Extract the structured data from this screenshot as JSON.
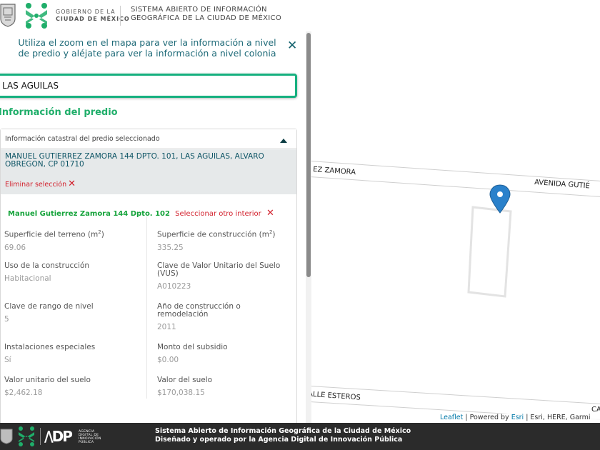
{
  "header": {
    "gob_line1": "GOBIERNO DE LA",
    "gob_line2": "CIUDAD DE MÉXICO",
    "title_line1": "SISTEMA ABIERTO DE INFORMACIÓN",
    "title_line2": "GEOGRÁFICA DE LA CIUDAD DE MÉXICO"
  },
  "panel": {
    "hint": "Utiliza el zoom en el mapa para ver la información a nivel de predio y aléjate para ver la información a nivel colonia",
    "search_value": "LAS AGUILAS",
    "section_title": "Información del predio",
    "card_header": "Información catastral del predio seleccionado",
    "address": "MANUEL GUTIERREZ ZAMORA 144 DPTO. 101, LAS AGUILAS, ALVARO OBREGON, CP 01710",
    "remove_selection": "Eliminar selección",
    "unit_name": "Manuel Gutierrez Zamora 144 Dpto. 102",
    "select_other": "Seleccionar otro interior",
    "fields": [
      {
        "label": "Superficie del terreno (m",
        "sup": "2",
        "label_end": ")",
        "value": "69.06"
      },
      {
        "label": "Superficie de construcción (m",
        "sup": "2",
        "label_end": ")",
        "value": "335.25"
      },
      {
        "label": "Uso de la construcción",
        "value": "Habitacional"
      },
      {
        "label": "Clave de Valor Unitario del Suelo (VUS)",
        "value": "A010223"
      },
      {
        "label": "Clave de rango de nivel",
        "value": "5"
      },
      {
        "label": "Año de construcción o remodelación",
        "value": "2011"
      },
      {
        "label": "Instalaciones especiales",
        "value": "Sí"
      },
      {
        "label": "Monto del subsidio",
        "value": "$0.00"
      },
      {
        "label": "Valor unitario del suelo",
        "value": "$2,462.18"
      },
      {
        "label": "Valor del suelo",
        "value": "$170,038.15"
      }
    ]
  },
  "map": {
    "street_1": "EZ ZAMORA",
    "street_2": "AVENIDA GUTIÉ",
    "street_3": "CALLE ESTEROS",
    "street_4": "CA",
    "attribution_leaflet": "Leaflet",
    "attribution_sep1": " | Powered by ",
    "attribution_esri": "Esri",
    "attribution_rest": " | Esri, HERE, Garmi",
    "marker_color": "#2a81cb"
  },
  "footer": {
    "adp_text_1": "AGENCIA",
    "adp_text_2": "DIGITAL DE",
    "adp_text_3": "INNOVACIÓN",
    "adp_text_4": "PÚBLICA",
    "line1": "Sistema Abierto de Información Geográfica de la Ciudad de México",
    "line2": "Diseñado y operado por la Agencia Digital de Innovación Pública"
  },
  "colors": {
    "accent_green": "#1fae6a",
    "teal": "#0e5566",
    "danger": "#d21f2b"
  }
}
